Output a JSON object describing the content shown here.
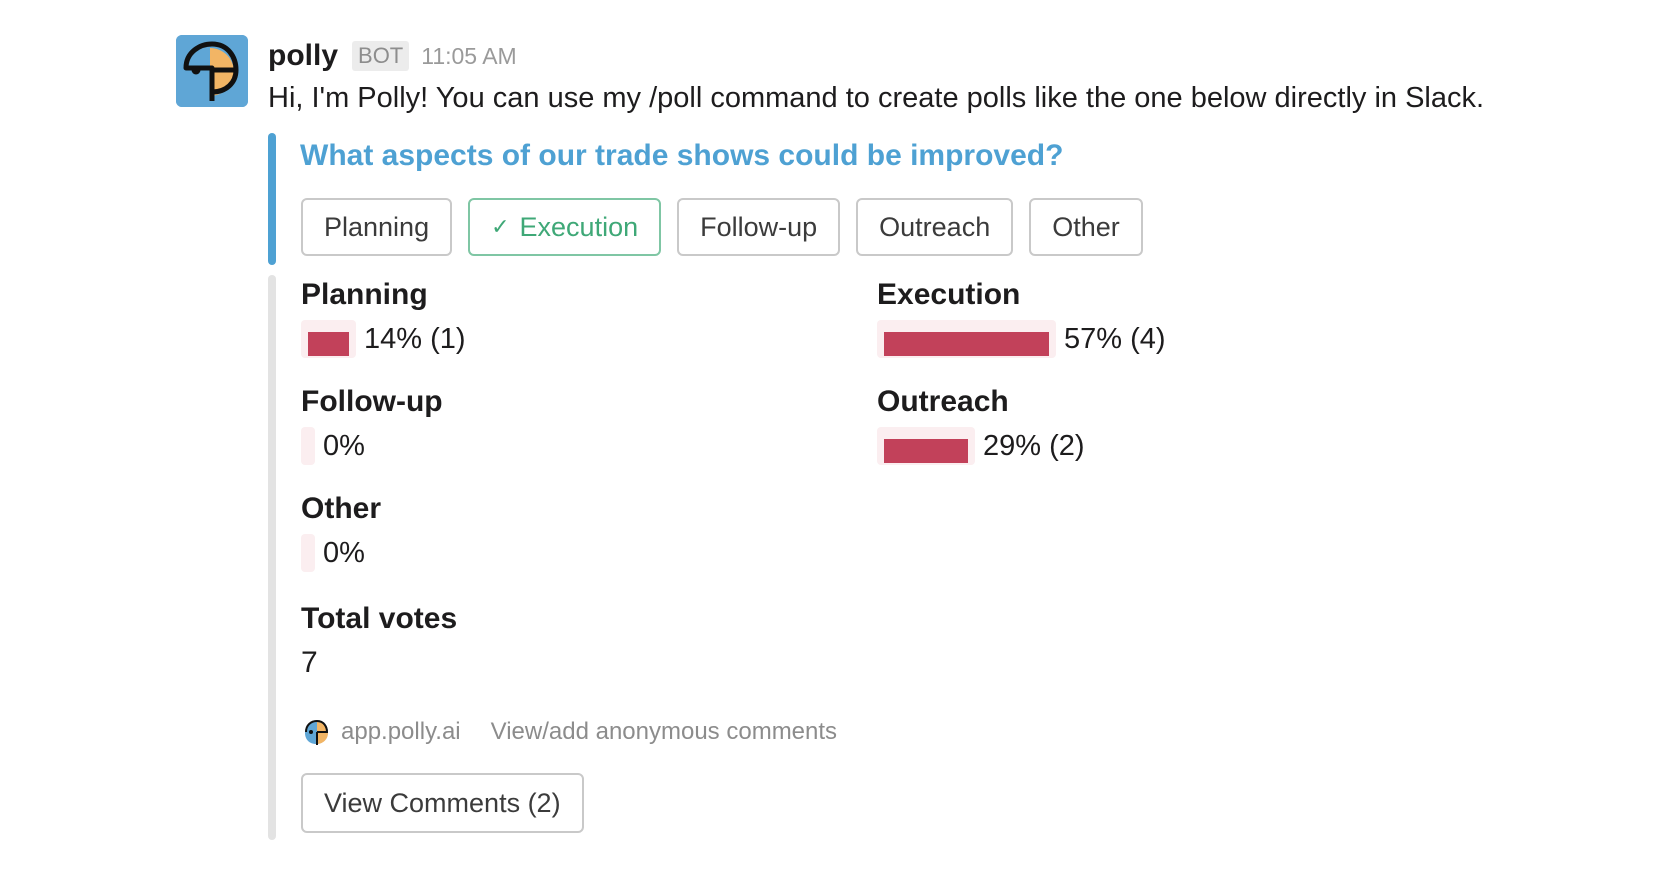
{
  "message": {
    "bot_name": "polly",
    "bot_badge": "BOT",
    "timestamp": "11:05 AM",
    "text": "Hi, I'm Polly! You can use my /poll command to create polls like the one below directly in Slack.",
    "avatar_icon": "polly-parrot-icon"
  },
  "poll": {
    "question": "What aspects of our trade shows could be improved?",
    "accent_color": "#4ea1d3",
    "bar_color": "#c2415a",
    "options": [
      {
        "label": "Planning",
        "selected": false
      },
      {
        "label": "Execution",
        "selected": true,
        "check": "✓"
      },
      {
        "label": "Follow-up",
        "selected": false
      },
      {
        "label": "Outreach",
        "selected": false
      },
      {
        "label": "Other",
        "selected": false
      }
    ],
    "results": [
      {
        "label": "Planning",
        "value_text": "14% (1)",
        "percent": 14
      },
      {
        "label": "Execution",
        "value_text": "57% (4)",
        "percent": 57
      },
      {
        "label": "Follow-up",
        "value_text": "0%",
        "percent": 0
      },
      {
        "label": "Outreach",
        "value_text": "29% (2)",
        "percent": 29
      },
      {
        "label": "Other",
        "value_text": "0%",
        "percent": 0
      }
    ],
    "total_votes_label": "Total votes",
    "total_votes": "7"
  },
  "footer": {
    "icon": "polly-parrot-icon",
    "source": "app.polly.ai",
    "action": "View/add anonymous comments"
  },
  "comments_button": "View Comments (2)"
}
